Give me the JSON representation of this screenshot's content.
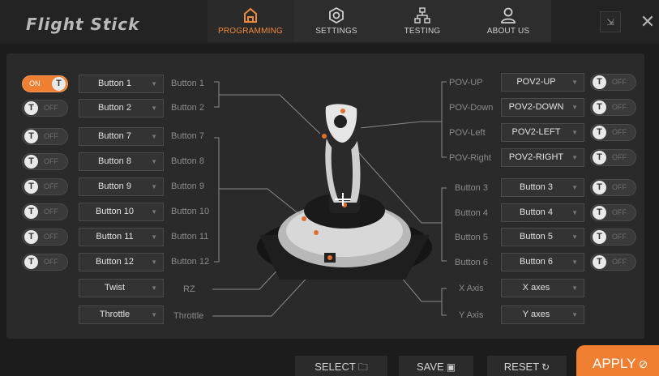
{
  "app": {
    "title": "Flight Stick"
  },
  "nav": [
    {
      "label": "PROGRAMMING",
      "icon": "home-icon",
      "active": true
    },
    {
      "label": "SETTINGS",
      "icon": "gear-icon",
      "active": false
    },
    {
      "label": "TESTING",
      "icon": "network-icon",
      "active": false
    },
    {
      "label": "ABOUT US",
      "icon": "user-icon",
      "active": false
    }
  ],
  "window": {
    "minimize_icon": "shrink-icon",
    "close_glyph": "✕",
    "shrink_glyph": "⇲"
  },
  "left_rows": [
    {
      "toggle": "ON",
      "toggle_letter": "T",
      "on": true,
      "select": "Button 1",
      "label": "Button 1"
    },
    {
      "toggle": "OFF",
      "toggle_letter": "T",
      "on": false,
      "select": "Button 2",
      "label": "Button 2"
    },
    {
      "toggle": "OFF",
      "toggle_letter": "T",
      "on": false,
      "select": "Button 7",
      "label": "Button 7"
    },
    {
      "toggle": "OFF",
      "toggle_letter": "T",
      "on": false,
      "select": "Button 8",
      "label": "Button 8"
    },
    {
      "toggle": "OFF",
      "toggle_letter": "T",
      "on": false,
      "select": "Button 9",
      "label": "Button 9"
    },
    {
      "toggle": "OFF",
      "toggle_letter": "T",
      "on": false,
      "select": "Button 10",
      "label": "Button 10"
    },
    {
      "toggle": "OFF",
      "toggle_letter": "T",
      "on": false,
      "select": "Button 11",
      "label": "Button 11"
    },
    {
      "toggle": "OFF",
      "toggle_letter": "T",
      "on": false,
      "select": "Button 12",
      "label": "Button 12"
    }
  ],
  "axis_left": [
    {
      "select": "Twist",
      "label": "RZ"
    },
    {
      "select": "Throttle",
      "label": "Throttle"
    }
  ],
  "right_rows": [
    {
      "label": "POV-UP",
      "select": "POV2-UP",
      "toggle": "OFF",
      "toggle_letter": "T"
    },
    {
      "label": "POV-Down",
      "select": "POV2-DOWN",
      "toggle": "OFF",
      "toggle_letter": "T"
    },
    {
      "label": "POV-Left",
      "select": "POV2-LEFT",
      "toggle": "OFF",
      "toggle_letter": "T"
    },
    {
      "label": "POV-Right",
      "select": "POV2-RIGHT",
      "toggle": "OFF",
      "toggle_letter": "T"
    },
    {
      "label": "Button 3",
      "select": "Button 3",
      "toggle": "OFF",
      "toggle_letter": "T"
    },
    {
      "label": "Button 4",
      "select": "Button 4",
      "toggle": "OFF",
      "toggle_letter": "T"
    },
    {
      "label": "Button 5",
      "select": "Button 5",
      "toggle": "OFF",
      "toggle_letter": "T"
    },
    {
      "label": "Button 6",
      "select": "Button 6",
      "toggle": "OFF",
      "toggle_letter": "T"
    }
  ],
  "axis_right": [
    {
      "label": "X Axis",
      "select": "X axes"
    },
    {
      "label": "Y Axis",
      "select": "Y axes"
    }
  ],
  "footer": {
    "select_label": "SELECT",
    "select_icon": "folder-icon",
    "select_glyph": "🗀",
    "save_label": "SAVE",
    "save_icon": "save-icon",
    "save_glyph": "▣",
    "reset_label": "RESET",
    "reset_icon": "reset-icon",
    "reset_glyph": "↻",
    "apply_label": "APPLY",
    "apply_icon": "check-icon",
    "apply_glyph": "⊘"
  },
  "colors": {
    "accent": "#f07f31",
    "background": "#1c1c1c",
    "panel": "#2a2a2a"
  }
}
